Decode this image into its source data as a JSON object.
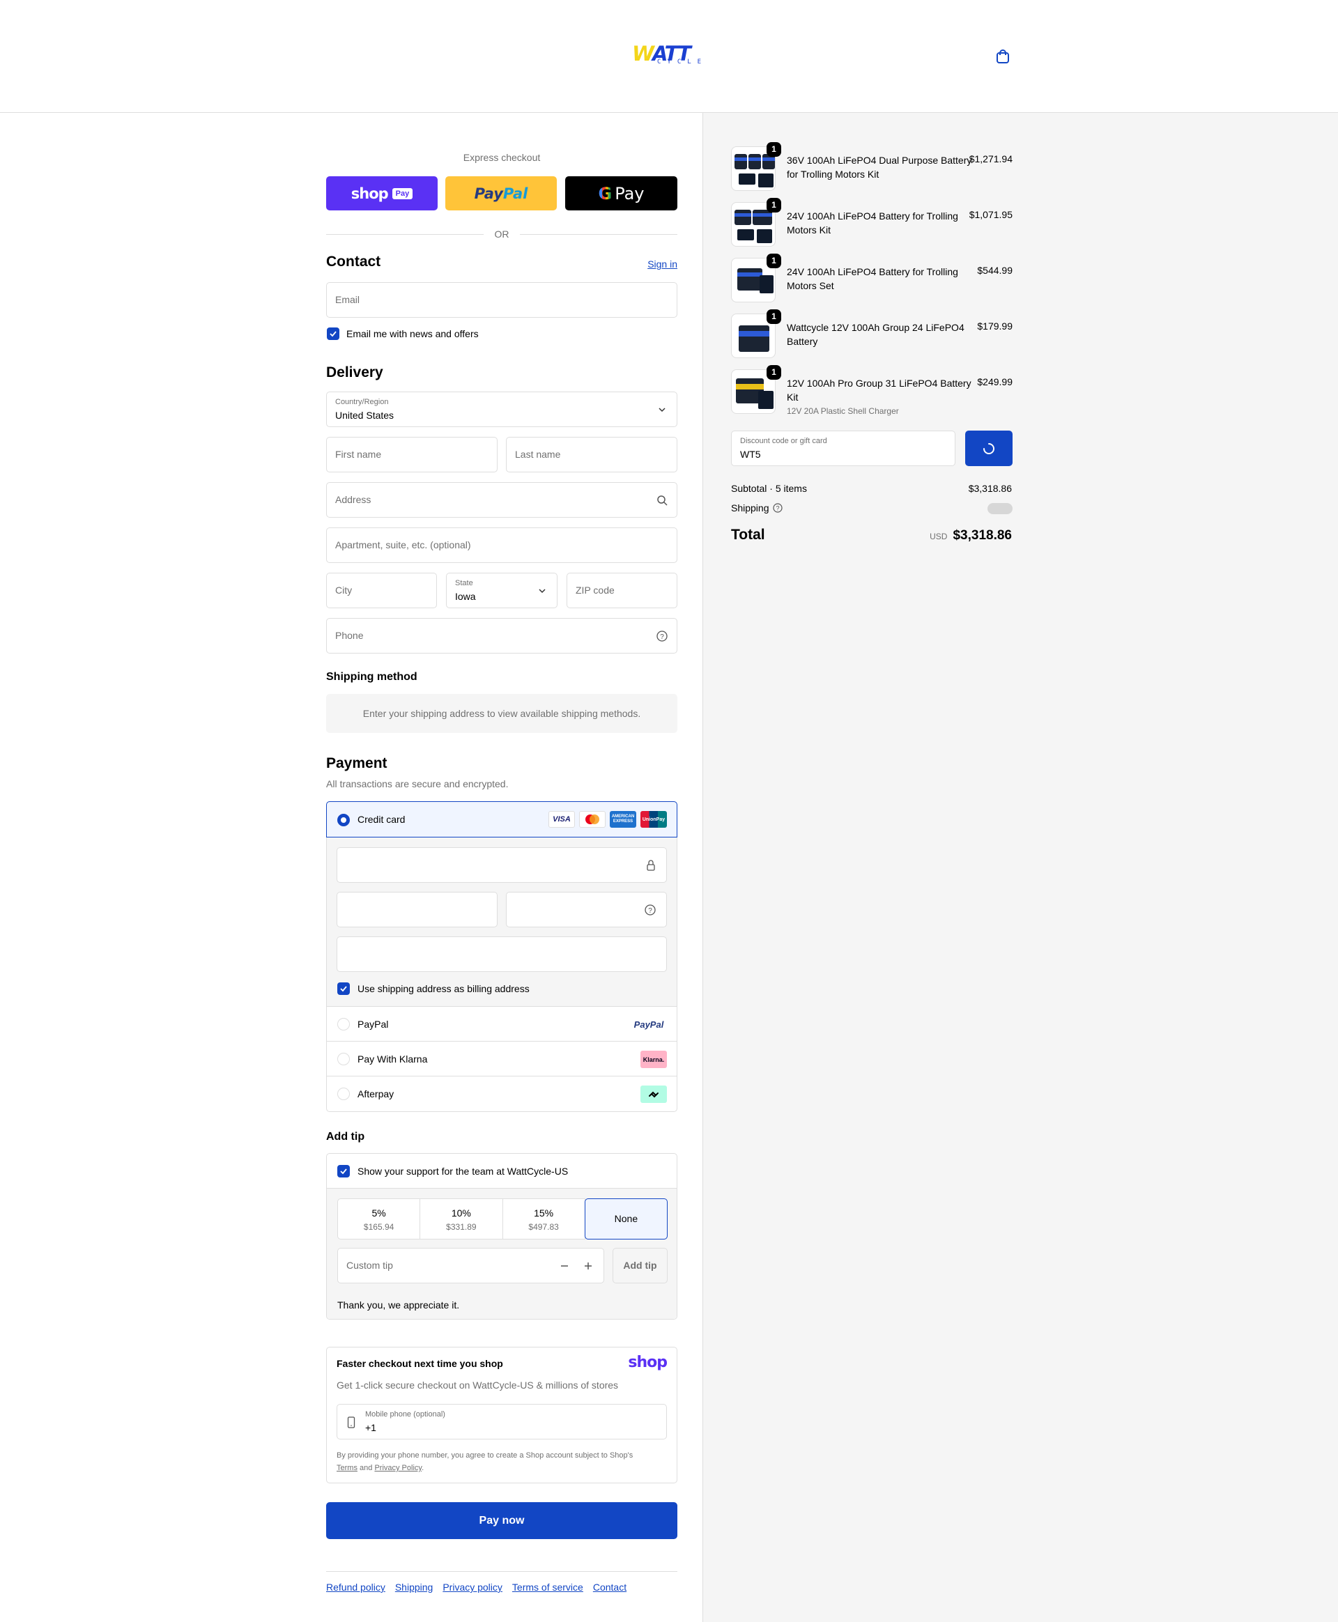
{
  "brand": {
    "logo_text": "WATT",
    "logo_subtext": "CYCLE"
  },
  "express": {
    "title": "Express checkout",
    "shop_label": "shop",
    "shop_badge": "Pay",
    "paypal_pay": "Pay",
    "paypal_pal": "Pal",
    "gpay_label": "Pay",
    "or": "OR"
  },
  "contact": {
    "title": "Contact",
    "sign_in": "Sign in",
    "email_placeholder": "Email",
    "newsletter_label": "Email me with news and offers"
  },
  "delivery": {
    "title": "Delivery",
    "country_label": "Country/Region",
    "country_value": "United States",
    "first_name": "First name",
    "last_name": "Last name",
    "address": "Address",
    "apartment": "Apartment, suite, etc. (optional)",
    "city": "City",
    "state_label": "State",
    "state_value": "Iowa",
    "zip": "ZIP code",
    "phone": "Phone"
  },
  "shipping_method": {
    "title": "Shipping method",
    "message": "Enter your shipping address to view available shipping methods."
  },
  "payment": {
    "title": "Payment",
    "subtitle": "All transactions are secure and encrypted.",
    "credit_card": "Credit card",
    "cards": {
      "visa": "VISA",
      "amex": "AMERICAN EXPRESS",
      "union": "UnionPay"
    },
    "billing_checkbox": "Use shipping address as billing address",
    "options": [
      "PayPal",
      "Pay With Klarna",
      "Afterpay"
    ],
    "paypal_badge": "PayPal",
    "klarna_badge": "Klarna."
  },
  "tip": {
    "title": "Add tip",
    "support_label": "Show your support for the team at WattCycle-US",
    "options": [
      {
        "percent": "5%",
        "amount": "$165.94"
      },
      {
        "percent": "10%",
        "amount": "$331.89"
      },
      {
        "percent": "15%",
        "amount": "$497.83"
      },
      {
        "percent": "None",
        "amount": ""
      }
    ],
    "custom_placeholder": "Custom tip",
    "add_button": "Add tip",
    "thanks": "Thank you, we appreciate it."
  },
  "shop_save": {
    "title": "Faster checkout next time you shop",
    "logo": "shop",
    "description": "Get 1-click secure checkout on WattCycle-US & millions of stores",
    "phone_label": "Mobile phone (optional)",
    "phone_value": "+1",
    "legal_prefix": "By providing your phone number, you agree to create a Shop account subject to Shop's",
    "terms": "Terms",
    "and": "and",
    "privacy": "Privacy Policy",
    "period": "."
  },
  "pay_now": "Pay now",
  "footer": [
    "Refund policy",
    "Shipping",
    "Privacy policy",
    "Terms of service",
    "Contact"
  ],
  "summary": {
    "items": [
      {
        "name": "36V 100Ah LiFePO4 Dual Purpose Battery for Trolling Motors Kit",
        "variant": "",
        "price": "$1,271.94",
        "qty": "1"
      },
      {
        "name": "24V 100Ah LiFePO4 Battery for Trolling Motors Kit",
        "variant": "",
        "price": "$1,071.95",
        "qty": "1"
      },
      {
        "name": "24V 100Ah LiFePO4 Battery for Trolling Motors Set",
        "variant": "",
        "price": "$544.99",
        "qty": "1"
      },
      {
        "name": "Wattcycle 12V 100Ah Group 24 LiFePO4 Battery",
        "variant": "",
        "price": "$179.99",
        "qty": "1"
      },
      {
        "name": "12V 100Ah Pro Group 31 LiFePO4 Battery Kit",
        "variant": "12V 20A Plastic Shell Charger",
        "price": "$249.99",
        "qty": "1"
      }
    ],
    "discount_label": "Discount code or gift card",
    "discount_value": "WT5",
    "subtotal_label": "Subtotal · 5 items",
    "subtotal_value": "$3,318.86",
    "shipping_label": "Shipping",
    "total_label": "Total",
    "currency": "USD",
    "total_value": "$3,318.86"
  },
  "colors": {
    "accent": "#1246c4",
    "shop_purple": "#5a31f4",
    "paypal_yellow": "#ffc439",
    "logo_yellow": "#f3d51a"
  }
}
